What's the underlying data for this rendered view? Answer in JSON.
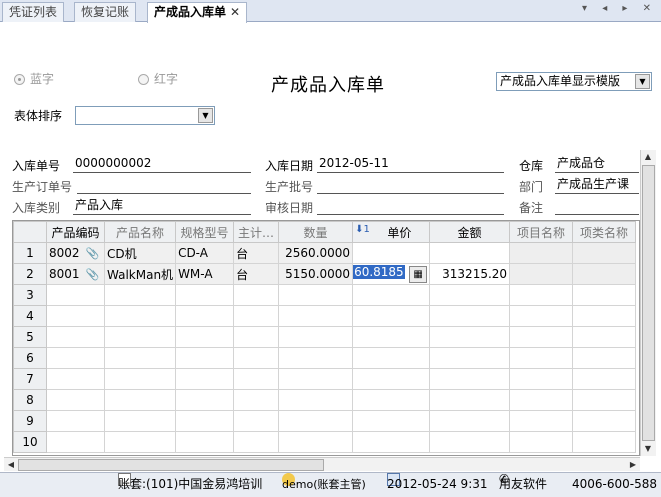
{
  "tabs": [
    {
      "label": "凭证列表"
    },
    {
      "label": "恢复记账"
    },
    {
      "label": "产成品入库单"
    }
  ],
  "tab_nav": "▾ ◂ ▸ ✕",
  "radio": {
    "blue_label": "蓝字",
    "red_label": "红字"
  },
  "doc_title": "产成品入库单",
  "template_select": "产成品入库单显示模版",
  "sort": {
    "label": "表体排序",
    "value": ""
  },
  "header_fields": {
    "receipt_no": {
      "label": "入库单号",
      "value": "0000000002"
    },
    "receipt_date": {
      "label": "入库日期",
      "value": "2012-05-11"
    },
    "warehouse": {
      "label": "仓库",
      "value": "产成品仓"
    },
    "prod_order": {
      "label": "生产订单号",
      "value": ""
    },
    "prod_batch": {
      "label": "生产批号",
      "value": ""
    },
    "department": {
      "label": "部门",
      "value": "产成品生产课"
    },
    "receipt_type": {
      "label": "入库类别",
      "value": "产品入库"
    },
    "audit_date": {
      "label": "审核日期",
      "value": ""
    },
    "remark": {
      "label": "备注",
      "value": ""
    }
  },
  "grid": {
    "columns": [
      "产品编码",
      "产品名称",
      "规格型号",
      "主计…",
      "数量",
      "单价",
      "金额",
      "项目名称",
      "项类名称"
    ],
    "rows": [
      {
        "no": "1",
        "code": "8002",
        "name": "CD机",
        "spec": "CD-A",
        "unit": "台",
        "qty": "2560.0000",
        "price": "",
        "amount": ""
      },
      {
        "no": "2",
        "code": "8001",
        "name": "WalkMan机",
        "spec": "WM-A",
        "unit": "台",
        "qty": "5150.0000",
        "price": "60.8185",
        "amount": "313215.20"
      }
    ],
    "empty_rows": [
      "3",
      "4",
      "5",
      "6",
      "7",
      "8",
      "9",
      "10"
    ]
  },
  "status": {
    "account": "账套:(101)中国金易鸿培训",
    "user": "demo(账套主管)",
    "datetime": "2012-05-24 9:31",
    "vendor": "用友软件",
    "phone": "4006-600-588"
  }
}
